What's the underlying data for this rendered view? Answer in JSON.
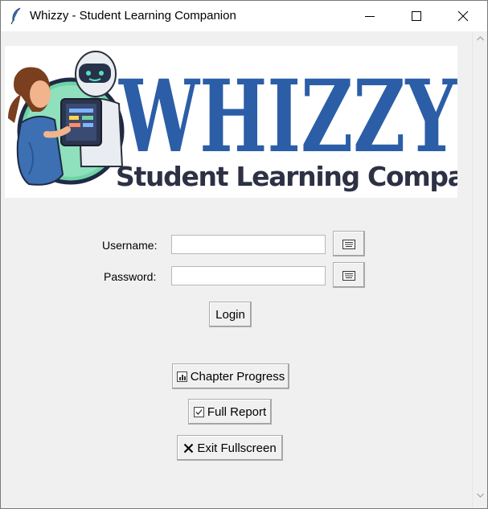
{
  "window": {
    "title": "Whizzy - Student Learning Companion",
    "controls": [
      "minimize-icon",
      "maximize-icon",
      "close-icon"
    ]
  },
  "banner": {
    "wordmark": "WHIZZY",
    "subtitle": "Student Learning Companion",
    "colors": {
      "wordmark": "#2b5ea7",
      "subtitle": "#2d3144",
      "ring": "#1f2a44",
      "mint": "#6fd3a6"
    }
  },
  "login_form": {
    "username_label": "Username:",
    "username_value": "",
    "password_label": "Password:",
    "password_value": "",
    "keyboard_icon": "keyboard-icon",
    "login_label": "Login"
  },
  "actions": {
    "chapter_progress_label": "Chapter Progress",
    "chapter_progress_icon": "bar-chart-icon",
    "full_report_label": "Full Report",
    "full_report_icon": "checkbox-icon",
    "exit_fullscreen_label": "Exit Fullscreen",
    "exit_fullscreen_icon": "x-mark-icon"
  },
  "scrollbar": {
    "icons": [
      "scroll-up-icon",
      "scroll-down-icon"
    ]
  }
}
